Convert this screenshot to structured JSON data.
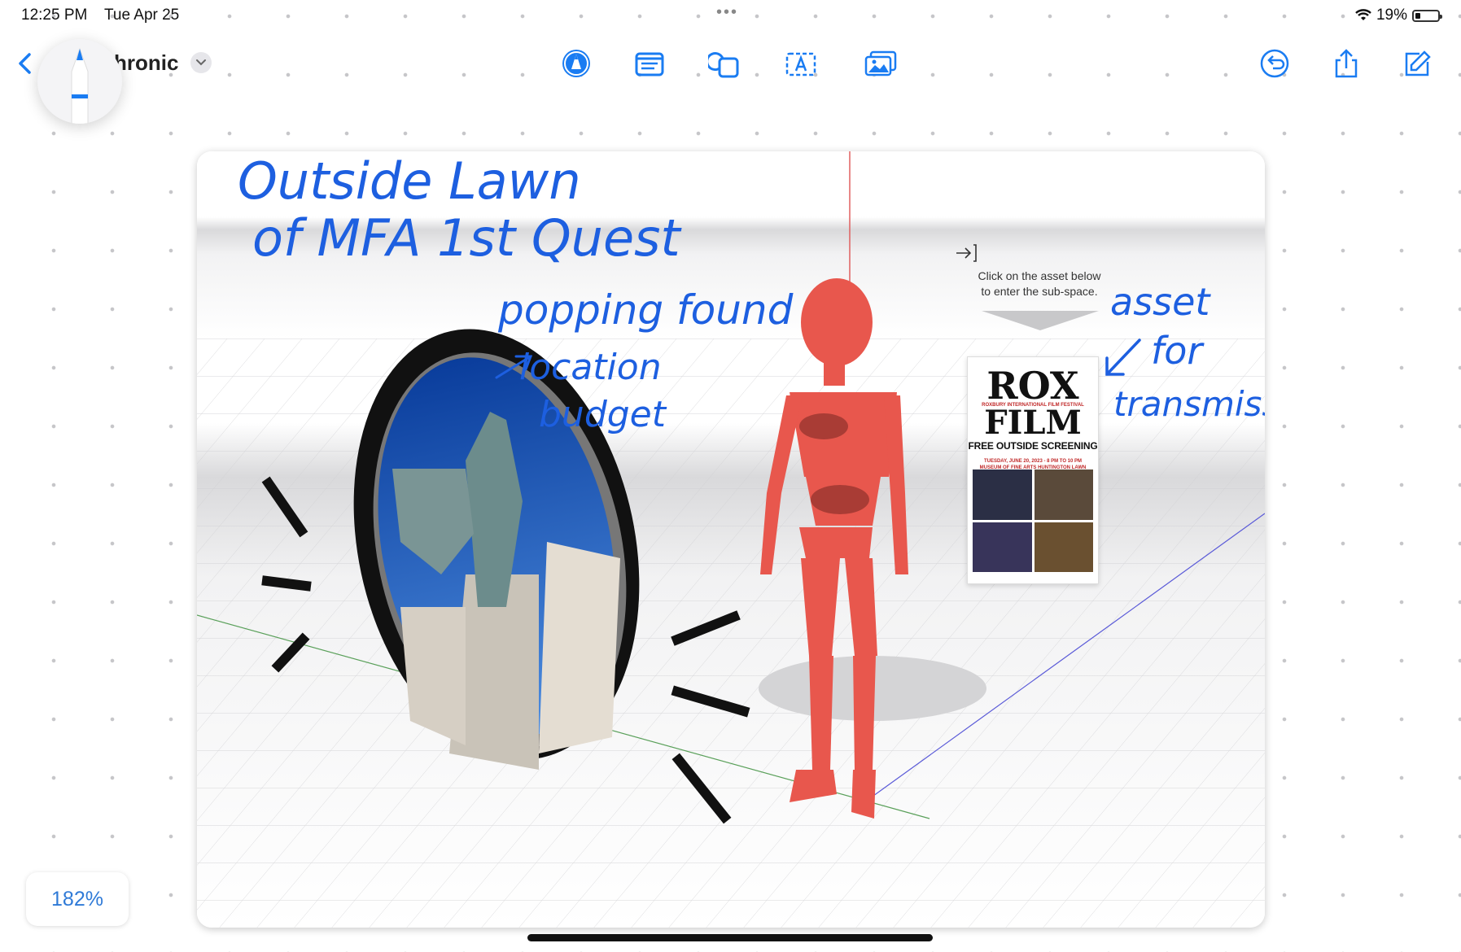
{
  "status_bar": {
    "time": "12:25 PM",
    "date": "Tue Apr 25",
    "battery": "19%"
  },
  "toolbar": {
    "title": "hronic",
    "back_label": "back",
    "tools": [
      {
        "name": "pen-tool",
        "icon": "pen-circle-icon"
      },
      {
        "name": "text-box",
        "icon": "text-box-icon"
      },
      {
        "name": "shapes",
        "icon": "shapes-icon"
      },
      {
        "name": "text",
        "icon": "text-A-icon"
      },
      {
        "name": "media",
        "icon": "photo-icon"
      }
    ],
    "actions": [
      {
        "name": "undo",
        "icon": "undo-icon"
      },
      {
        "name": "share",
        "icon": "share-icon"
      },
      {
        "name": "new-board",
        "icon": "compose-icon"
      }
    ],
    "accent_color": "#1a7cf2"
  },
  "canvas": {
    "handwriting": {
      "line1": "Outside Lawn",
      "line2": "of MFA 1st Quest",
      "popping": "popping found",
      "location": "location",
      "budget": "budget",
      "asset": "asset",
      "for": "for",
      "transmission": "transmission"
    },
    "hint": {
      "line1": "Click on the asset below",
      "line2": "to enter the sub-space."
    },
    "poster": {
      "rox": "ROX",
      "festival": "ROXBURY INTERNATIONAL FILM FESTIVAL",
      "film": "FILM",
      "screening": "FREE OUTSIDE SCREENING",
      "date": "TUESDAY, JUNE 20, 2023 - 8 PM TO 10 PM",
      "venue": "MUSEUM OF FINE ARTS HUNTINGTON LAWN"
    },
    "ink_color": "#1d5fe0",
    "figure_color": "#e8574d"
  },
  "zoom": {
    "level": "182%"
  }
}
